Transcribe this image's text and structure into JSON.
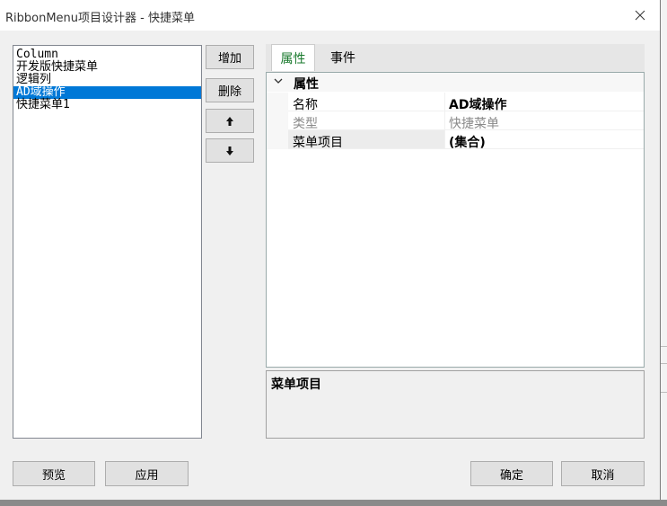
{
  "window": {
    "title": "RibbonMenu项目设计器 - 快捷菜单"
  },
  "items": [
    {
      "label": "Column",
      "selected": false
    },
    {
      "label": "开发版快捷菜单",
      "selected": false
    },
    {
      "label": "逻辑列",
      "selected": false
    },
    {
      "label": "AD域操作",
      "selected": true
    },
    {
      "label": "快捷菜单1",
      "selected": false
    }
  ],
  "side_buttons": {
    "add": "增加",
    "delete": "删除",
    "up_icon": "arrow-up-icon",
    "down_icon": "arrow-down-icon"
  },
  "tabs": [
    {
      "label": "属性",
      "active": true
    },
    {
      "label": "事件",
      "active": false
    }
  ],
  "property_grid": {
    "category": "属性",
    "rows": [
      {
        "name": "名称",
        "value": "AD域操作",
        "bold": true,
        "readonly": false
      },
      {
        "name": "类型",
        "value": "快捷菜单",
        "bold": false,
        "readonly": true
      },
      {
        "name": "菜单项目",
        "value": "(集合)",
        "bold": true,
        "readonly": false
      }
    ]
  },
  "description": {
    "title": "菜单项目"
  },
  "footer": {
    "preview": "预览",
    "apply": "应用",
    "ok": "确定",
    "cancel": "取消"
  },
  "colors": {
    "selection": "#0078d7",
    "active_tab_text": "#1a7a2e"
  }
}
